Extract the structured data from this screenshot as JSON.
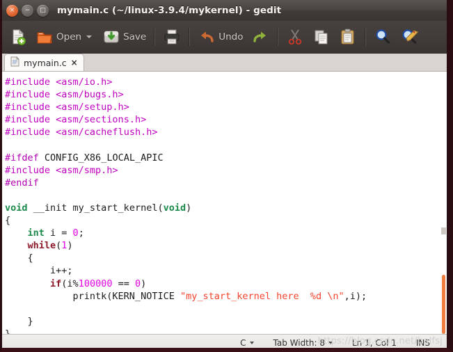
{
  "window": {
    "title": "mymain.c (~/linux-3.9.4/mykernel) - gedit",
    "buttons": {
      "close": "×",
      "minimize": "−",
      "maximize": "□"
    }
  },
  "toolbar": {
    "new_label": "",
    "open_label": "Open",
    "save_label": "Save",
    "print_label": "",
    "undo_label": "Undo",
    "redo_label": "",
    "cut_label": "",
    "copy_label": "",
    "paste_label": "",
    "find_label": "",
    "replace_label": ""
  },
  "tabs": [
    {
      "name": "mymain.c",
      "close": "×"
    }
  ],
  "editor": {
    "lines": [
      [
        {
          "t": "#include ",
          "c": "pp"
        },
        {
          "t": "<asm/io.h>",
          "c": "pp"
        }
      ],
      [
        {
          "t": "#include ",
          "c": "pp"
        },
        {
          "t": "<asm/bugs.h>",
          "c": "pp"
        }
      ],
      [
        {
          "t": "#include ",
          "c": "pp"
        },
        {
          "t": "<asm/setup.h>",
          "c": "pp"
        }
      ],
      [
        {
          "t": "#include ",
          "c": "pp"
        },
        {
          "t": "<asm/sections.h>",
          "c": "pp"
        }
      ],
      [
        {
          "t": "#include ",
          "c": "pp"
        },
        {
          "t": "<asm/cacheflush.h>",
          "c": "pp"
        }
      ],
      [],
      [
        {
          "t": "#ifdef",
          "c": "ppk"
        },
        {
          "t": " CONFIG_X86_LOCAL_APIC",
          "c": "plain"
        }
      ],
      [
        {
          "t": "#include ",
          "c": "pp"
        },
        {
          "t": "<asm/smp.h>",
          "c": "pp"
        }
      ],
      [
        {
          "t": "#endif",
          "c": "ppk"
        }
      ],
      [],
      [
        {
          "t": "void",
          "c": "kw"
        },
        {
          "t": " __init my_start_kernel(",
          "c": "plain"
        },
        {
          "t": "void",
          "c": "kw"
        },
        {
          "t": ")",
          "c": "plain"
        }
      ],
      [
        {
          "t": "{",
          "c": "plain"
        }
      ],
      [
        {
          "t": "    ",
          "c": "plain"
        },
        {
          "t": "int",
          "c": "kw"
        },
        {
          "t": " i = ",
          "c": "plain"
        },
        {
          "t": "0",
          "c": "num"
        },
        {
          "t": ";",
          "c": "plain"
        }
      ],
      [
        {
          "t": "    ",
          "c": "plain"
        },
        {
          "t": "while",
          "c": "ctl"
        },
        {
          "t": "(",
          "c": "plain"
        },
        {
          "t": "1",
          "c": "num"
        },
        {
          "t": ")",
          "c": "plain"
        }
      ],
      [
        {
          "t": "    {",
          "c": "plain"
        }
      ],
      [
        {
          "t": "        i++;",
          "c": "plain"
        }
      ],
      [
        {
          "t": "        ",
          "c": "plain"
        },
        {
          "t": "if",
          "c": "ctl"
        },
        {
          "t": "(i%",
          "c": "plain"
        },
        {
          "t": "100000",
          "c": "num"
        },
        {
          "t": " == ",
          "c": "plain"
        },
        {
          "t": "0",
          "c": "num"
        },
        {
          "t": ")",
          "c": "plain"
        }
      ],
      [
        {
          "t": "            printk(KERN_NOTICE ",
          "c": "plain"
        },
        {
          "t": "\"my_start_kernel here  %d \\n\"",
          "c": "str"
        },
        {
          "t": ",i);",
          "c": "plain"
        }
      ],
      [],
      [
        {
          "t": "    }",
          "c": "plain"
        }
      ],
      [
        {
          "t": "}",
          "c": "plain"
        }
      ]
    ]
  },
  "statusbar": {
    "language": "C",
    "tab_width": "Tab Width: 8",
    "position": "Ln 1, Col 1",
    "insert_mode": "INS",
    "watermark": "https://blog.csdn.net/balfsj"
  },
  "colors": {
    "accent_orange": "#ef7e42",
    "titlebar": "#433d3a",
    "toolbar": "#413b39",
    "preprocessor": "#c000c0",
    "keyword": "#1a8a4a",
    "control": "#8b1a2b",
    "number": "#e300e3",
    "string": "#f4442e"
  }
}
